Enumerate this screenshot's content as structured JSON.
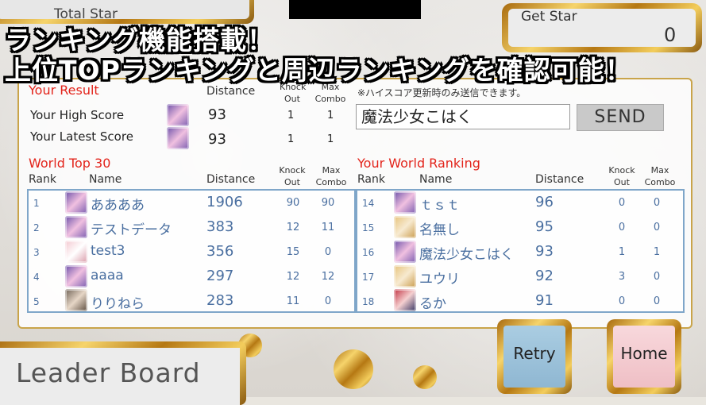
{
  "header": {
    "total_star_label": "Total Star",
    "get_star_label": "Get Star",
    "get_star_value": "0"
  },
  "banner": {
    "line1": "ランキング機能搭載！",
    "line2": "上位TOPランキングと周辺ランキングを確認可能！"
  },
  "your_result": {
    "title": "Your Result",
    "col_distance": "Distance",
    "col_knock": "Knock",
    "col_knock2": "Out",
    "col_max": "Max",
    "col_max2": "Combo",
    "high": {
      "label": "Your High Score",
      "distance": "93",
      "knock": "1",
      "combo": "1"
    },
    "latest": {
      "label": "Your Latest Score",
      "distance": "93",
      "knock": "1",
      "combo": "1"
    }
  },
  "submit": {
    "note": "※ハイスコア更新時のみ送信できます。",
    "name_value": "魔法少女こはく",
    "send_label": "SEND"
  },
  "world_top": {
    "title": "World Top 30",
    "col_rank": "Rank",
    "col_name": "Name",
    "col_distance": "Distance",
    "col_knock": "Knock",
    "col_knock2": "Out",
    "col_max": "Max",
    "col_max2": "Combo",
    "rows": [
      {
        "rank": "1",
        "name": "ああああ",
        "distance": "1906",
        "knock": "90",
        "combo": "90"
      },
      {
        "rank": "2",
        "name": "テストデータ",
        "distance": "383",
        "knock": "12",
        "combo": "11"
      },
      {
        "rank": "3",
        "name": "test3",
        "distance": "356",
        "knock": "15",
        "combo": "0"
      },
      {
        "rank": "4",
        "name": "aaaa",
        "distance": "297",
        "knock": "12",
        "combo": "12"
      },
      {
        "rank": "5",
        "name": "りりねら",
        "distance": "283",
        "knock": "11",
        "combo": "0"
      }
    ]
  },
  "your_ranking": {
    "title": "Your World Ranking",
    "col_rank": "Rank",
    "col_name": "Name",
    "col_distance": "Distance",
    "col_knock": "Knock",
    "col_knock2": "Out",
    "col_max": "Max",
    "col_max2": "Combo",
    "rows": [
      {
        "rank": "14",
        "name": "ｔｓｔ",
        "distance": "96",
        "knock": "0",
        "combo": "0"
      },
      {
        "rank": "15",
        "name": "名無し",
        "distance": "95",
        "knock": "0",
        "combo": "0"
      },
      {
        "rank": "16",
        "name": "魔法少女こはく",
        "distance": "93",
        "knock": "1",
        "combo": "1"
      },
      {
        "rank": "17",
        "name": "ユウリ",
        "distance": "92",
        "knock": "3",
        "combo": "0"
      },
      {
        "rank": "18",
        "name": "るか",
        "distance": "91",
        "knock": "0",
        "combo": "0"
      }
    ]
  },
  "footer": {
    "leader_board": "Leader Board",
    "retry_label": "Retry",
    "home_label": "Home"
  }
}
